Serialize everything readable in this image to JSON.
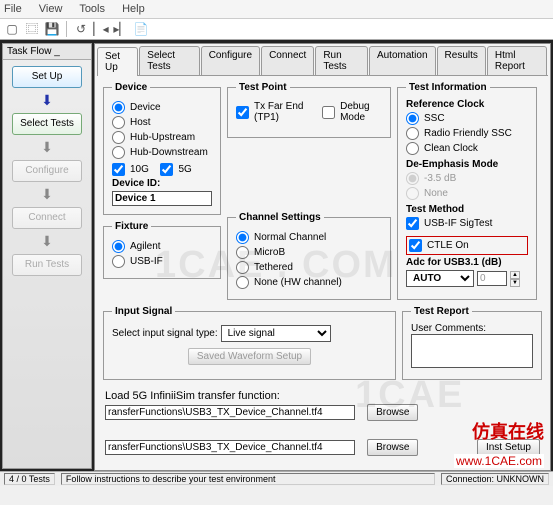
{
  "menu": {
    "file": "File",
    "view": "View",
    "tools": "Tools",
    "help": "Help"
  },
  "taskflow": {
    "title": "Task Flow _",
    "steps": [
      "Set Up",
      "Select Tests",
      "Configure",
      "Connect",
      "Run Tests"
    ]
  },
  "tabs": [
    "Set Up",
    "Select Tests",
    "Configure",
    "Connect",
    "Run Tests",
    "Automation",
    "Results",
    "Html Report"
  ],
  "device": {
    "legend": "Device",
    "opt_device": "Device",
    "opt_host": "Host",
    "opt_hubup": "Hub-Upstream",
    "opt_hubdown": "Hub-Downstream",
    "chk_10g": "10G",
    "chk_5g": "5G",
    "id_label": "Device ID:",
    "id_value": "Device 1"
  },
  "fixture": {
    "legend": "Fixture",
    "opt_agilent": "Agilent",
    "opt_usbif": "USB-IF"
  },
  "testpoint": {
    "legend": "Test Point",
    "chk_tx": "Tx Far End (TP1)",
    "chk_debug": "Debug Mode"
  },
  "chset": {
    "legend": "Channel Settings",
    "opt_normal": "Normal Channel",
    "opt_microb": "MicroB",
    "opt_teth": "Tethered",
    "opt_none": "None (HW channel)"
  },
  "testinfo": {
    "legend": "Test Information",
    "refclock": "Reference Clock",
    "ssc": "SSC",
    "radio": "Radio Friendly SSC",
    "clean": "Clean Clock",
    "deemph": "De-Emphasis Mode",
    "d35": "-3.5 dB",
    "dnone": "None",
    "testmethod": "Test Method",
    "sigtest": "USB-IF SigTest",
    "ctle": "CTLE On",
    "adc": "Adc for USB3.1 (dB)",
    "adc_sel": "AUTO",
    "adc_spin": "0"
  },
  "inputsig": {
    "legend": "Input Signal",
    "label": "Select input signal type:",
    "value": "Live signal",
    "btn_saved": "Saved Waveform Setup"
  },
  "testreport": {
    "legend": "Test Report",
    "comments": "User Comments:"
  },
  "transfer": {
    "load_label": "Load 5G InfiniiSim transfer function:",
    "path1": "ransferFunctions\\USB3_TX_Device_Channel.tf4",
    "path2": "ransferFunctions\\USB3_TX_Device_Channel.tf4",
    "browse": "Browse",
    "inst": "Inst Setup"
  },
  "status": {
    "a": "4 / 0 Tests",
    "b": "Follow instructions to describe your test environment",
    "c": "Connection: UNKNOWN"
  },
  "watermark_cn": "仿真在线",
  "watermark_url": "www.1CAE.com"
}
